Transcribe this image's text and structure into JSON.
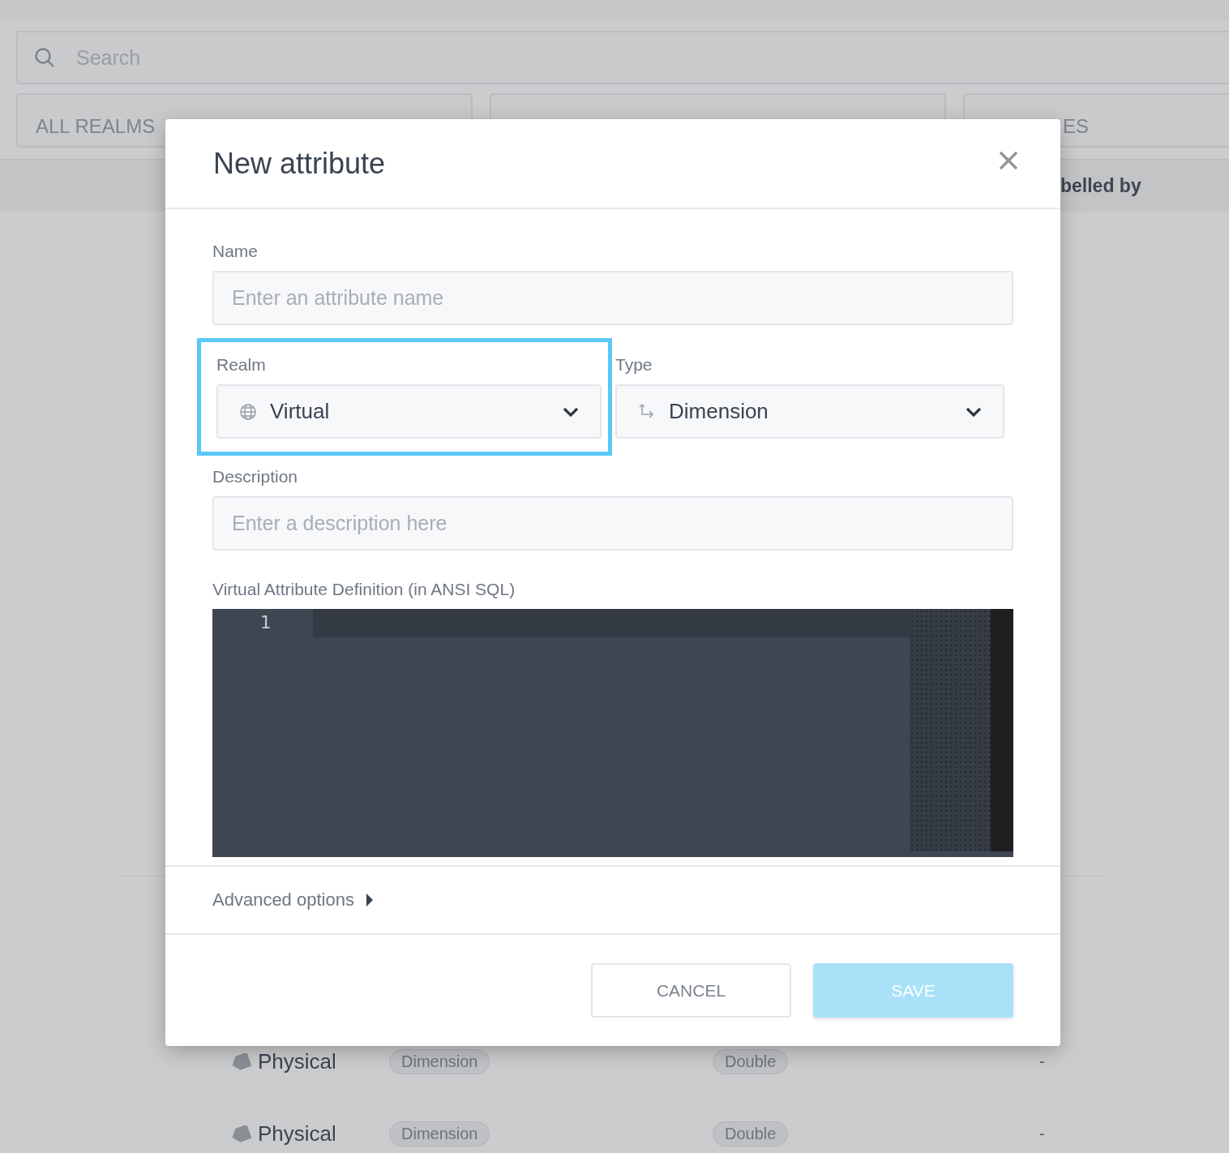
{
  "search": {
    "placeholder": "Search"
  },
  "filters": [
    {
      "kind": "visible",
      "label": "ALL REALMS"
    },
    {
      "kind": "covered"
    },
    {
      "kind": "covered",
      "label": "ES"
    }
  ],
  "table": {
    "header": [
      "belled by"
    ],
    "rows": [
      {
        "realm": "Physical",
        "category": "Dimension",
        "type": "Double",
        "labelled_by": "-"
      },
      {
        "realm": "Physical",
        "category": "Dimension",
        "type": "Double",
        "labelled_by": "-"
      }
    ]
  },
  "dialog": {
    "title": "New attribute",
    "name": {
      "label": "Name",
      "placeholder": "Enter an attribute name"
    },
    "realm": {
      "label": "Realm",
      "value": "Virtual",
      "highlighted": true
    },
    "type": {
      "label": "Type",
      "value": "Dimension",
      "highlighted": false
    },
    "description": {
      "label": "Description",
      "placeholder": "Enter a description here"
    },
    "sql": {
      "label": "Virtual Attribute Definition (in ANSI SQL)",
      "line_numbers": [
        "1"
      ]
    },
    "advanced": {
      "label": "Advanced options",
      "expanded": false
    },
    "buttons": [
      {
        "label": "CANCEL",
        "kind": "secondary",
        "disabled": false
      },
      {
        "label": "SAVE",
        "kind": "primary",
        "disabled": true
      }
    ]
  }
}
